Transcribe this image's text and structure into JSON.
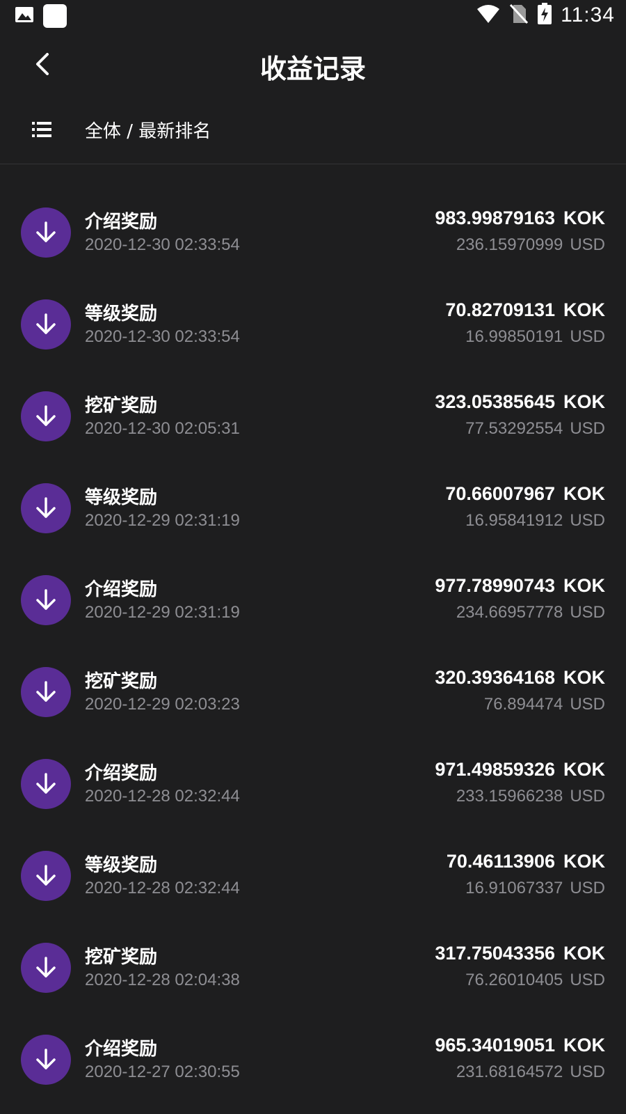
{
  "status_bar": {
    "time": "11:34",
    "icons": [
      "image-icon",
      "app-icon",
      "wifi-icon",
      "no-sim-icon",
      "battery-charging-icon"
    ]
  },
  "header": {
    "title": "收益记录",
    "back_icon": "chevron-left-icon"
  },
  "filter": {
    "icon": "list-icon",
    "label": "全体 / 最新排名"
  },
  "colors": {
    "background": "#1e1e1f",
    "accent": "#5a2d96",
    "secondary_text": "#8e8e93"
  },
  "records": [
    {
      "title": "介绍奖励",
      "date": "2020-12-30 02:33:54",
      "amount": "983.99879163",
      "amount_unit": "KOK",
      "usd": "236.15970999",
      "usd_unit": "USD"
    },
    {
      "title": "等级奖励",
      "date": "2020-12-30 02:33:54",
      "amount": "70.82709131",
      "amount_unit": "KOK",
      "usd": "16.99850191",
      "usd_unit": "USD"
    },
    {
      "title": "挖矿奖励",
      "date": "2020-12-30 02:05:31",
      "amount": "323.05385645",
      "amount_unit": "KOK",
      "usd": "77.53292554",
      "usd_unit": "USD"
    },
    {
      "title": "等级奖励",
      "date": "2020-12-29 02:31:19",
      "amount": "70.66007967",
      "amount_unit": "KOK",
      "usd": "16.95841912",
      "usd_unit": "USD"
    },
    {
      "title": "介绍奖励",
      "date": "2020-12-29 02:31:19",
      "amount": "977.78990743",
      "amount_unit": "KOK",
      "usd": "234.66957778",
      "usd_unit": "USD"
    },
    {
      "title": "挖矿奖励",
      "date": "2020-12-29 02:03:23",
      "amount": "320.39364168",
      "amount_unit": "KOK",
      "usd": "76.894474",
      "usd_unit": "USD"
    },
    {
      "title": "介绍奖励",
      "date": "2020-12-28 02:32:44",
      "amount": "971.49859326",
      "amount_unit": "KOK",
      "usd": "233.15966238",
      "usd_unit": "USD"
    },
    {
      "title": "等级奖励",
      "date": "2020-12-28 02:32:44",
      "amount": "70.46113906",
      "amount_unit": "KOK",
      "usd": "16.91067337",
      "usd_unit": "USD"
    },
    {
      "title": "挖矿奖励",
      "date": "2020-12-28 02:04:38",
      "amount": "317.75043356",
      "amount_unit": "KOK",
      "usd": "76.26010405",
      "usd_unit": "USD"
    },
    {
      "title": "介绍奖励",
      "date": "2020-12-27 02:30:55",
      "amount": "965.34019051",
      "amount_unit": "KOK",
      "usd": "231.68164572",
      "usd_unit": "USD"
    }
  ]
}
